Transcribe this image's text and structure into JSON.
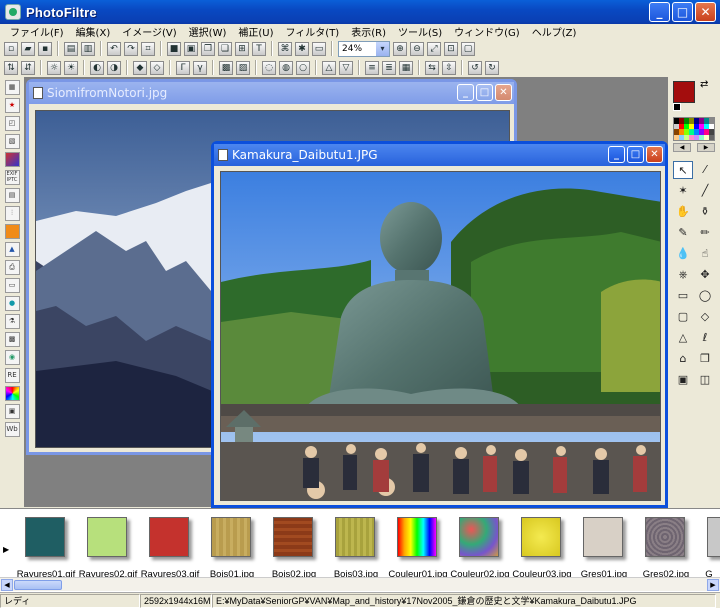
{
  "app": {
    "title": "PhotoFiltre"
  },
  "window_buttons": {
    "min": "_",
    "max": "□",
    "close": "✕"
  },
  "menu": [
    "ファイル(F)",
    "編集(X)",
    "イメージ(V)",
    "選択(W)",
    "補正(U)",
    "フィルタ(T)",
    "表示(R)",
    "ツール(S)",
    "ウィンドウ(G)",
    "ヘルプ(Z)"
  ],
  "toolbar": {
    "zoom_value": "24%",
    "zoom_arrow": "▾"
  },
  "documents": [
    {
      "title": "SiomifromNotori.jpg",
      "state": "inactive"
    },
    {
      "title": "Kamakura_Daibutu1.JPG",
      "state": "active"
    }
  ],
  "left_bar_labels": {
    "exif": "EXIF IPTC",
    "re": "RE",
    "wb": "Wb"
  },
  "colors": {
    "foreground": "#a30d0d",
    "background": "#000000",
    "accent": "#0b4fdc"
  },
  "palette_nav": {
    "prev": "◀",
    "next": "▶"
  },
  "thumbnails": [
    {
      "name": "Rayures01.gif",
      "color": "#1f5e63"
    },
    {
      "name": "Rayures02.gif",
      "color": "#b7e07c"
    },
    {
      "name": "Rayures03.gif",
      "color": "#c4322d"
    },
    {
      "name": "Bois01.jpg",
      "color": "#b99c4e"
    },
    {
      "name": "Bois02.jpg",
      "color": "#8c3a18"
    },
    {
      "name": "Bois03.jpg",
      "color": "#a8a23d"
    },
    {
      "name": "Couleur01.jpg",
      "color": "rainbow"
    },
    {
      "name": "Couleur02.jpg",
      "color": "#7a5ea8"
    },
    {
      "name": "Couleur03.jpg",
      "color": "#e6da2a"
    },
    {
      "name": "Gres01.jpg",
      "color": "#d8d0c6"
    },
    {
      "name": "Gres02.jpg",
      "color": "#8a7f86"
    },
    {
      "name": "G",
      "color": "#c8c8c8"
    }
  ],
  "status": {
    "state": "レディ",
    "dimensions": "2592x1944x16M",
    "path": "E:¥MyData¥SeniorGP¥VAN¥Map_and_history¥17Nov2005_鎌倉の歴史と文学¥Kamakura_Daibutu1.JPG"
  }
}
